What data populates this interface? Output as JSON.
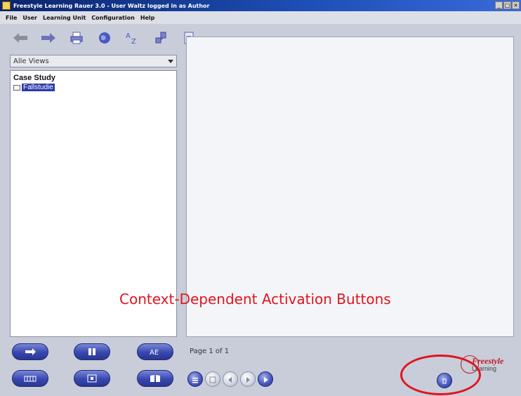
{
  "window": {
    "title": "Freestyle Learning Rauer 3.0 - User Waltz logged in as Author",
    "controls": [
      "_",
      "□",
      "×"
    ]
  },
  "menu": [
    "File",
    "User",
    "Learning Unit",
    "Configuration",
    "Help"
  ],
  "toolbar_icons": [
    "back-arrow-icon",
    "forward-arrow-icon",
    "print-icon",
    "globe-icon",
    "az-sort-icon",
    "connect-icon",
    "document-icon"
  ],
  "left_panel": {
    "view_select": "Alle Views",
    "tree_title": "Case Study",
    "tree_node": "Fallstudie"
  },
  "annotation": "Context-Dependent Activation Buttons",
  "page_label": "Page 1 of 1",
  "logo": {
    "main": "Freestyle",
    "sub": "Learning"
  },
  "colors": {
    "accent": "#3847b0",
    "annotation": "#e0141e",
    "selection": "#2b3aa8"
  }
}
